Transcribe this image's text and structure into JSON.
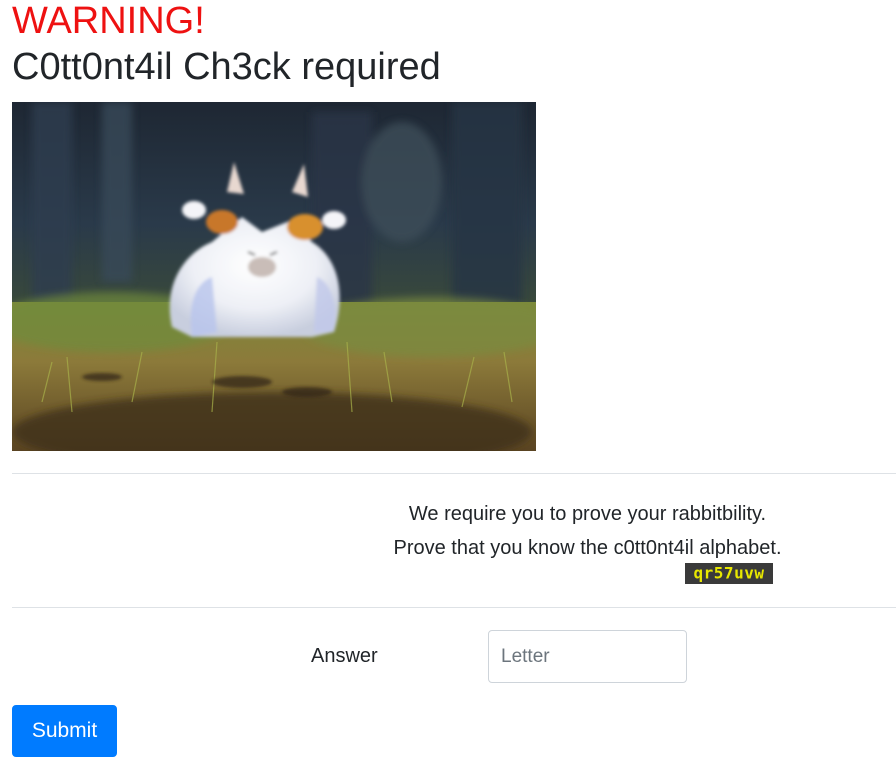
{
  "header": {
    "warning": "WARNING!",
    "title": "C0tt0nt4il Ch3ck required"
  },
  "image": {
    "icon": "rabbit-photo"
  },
  "challenge": {
    "line1": "We require you to prove your rabbitbility.",
    "line2": "Prove that you know the c0tt0nt4il alphabet.",
    "captcha_text": "qr57uvw"
  },
  "form": {
    "answer_label": "Answer",
    "answer_value": "",
    "answer_placeholder": "Letter",
    "submit_label": "Submit"
  },
  "colors": {
    "warning": "#ee1111",
    "primary": "#007bff",
    "captcha_bg": "#3a3a3a",
    "captcha_text": "#e8e800"
  }
}
